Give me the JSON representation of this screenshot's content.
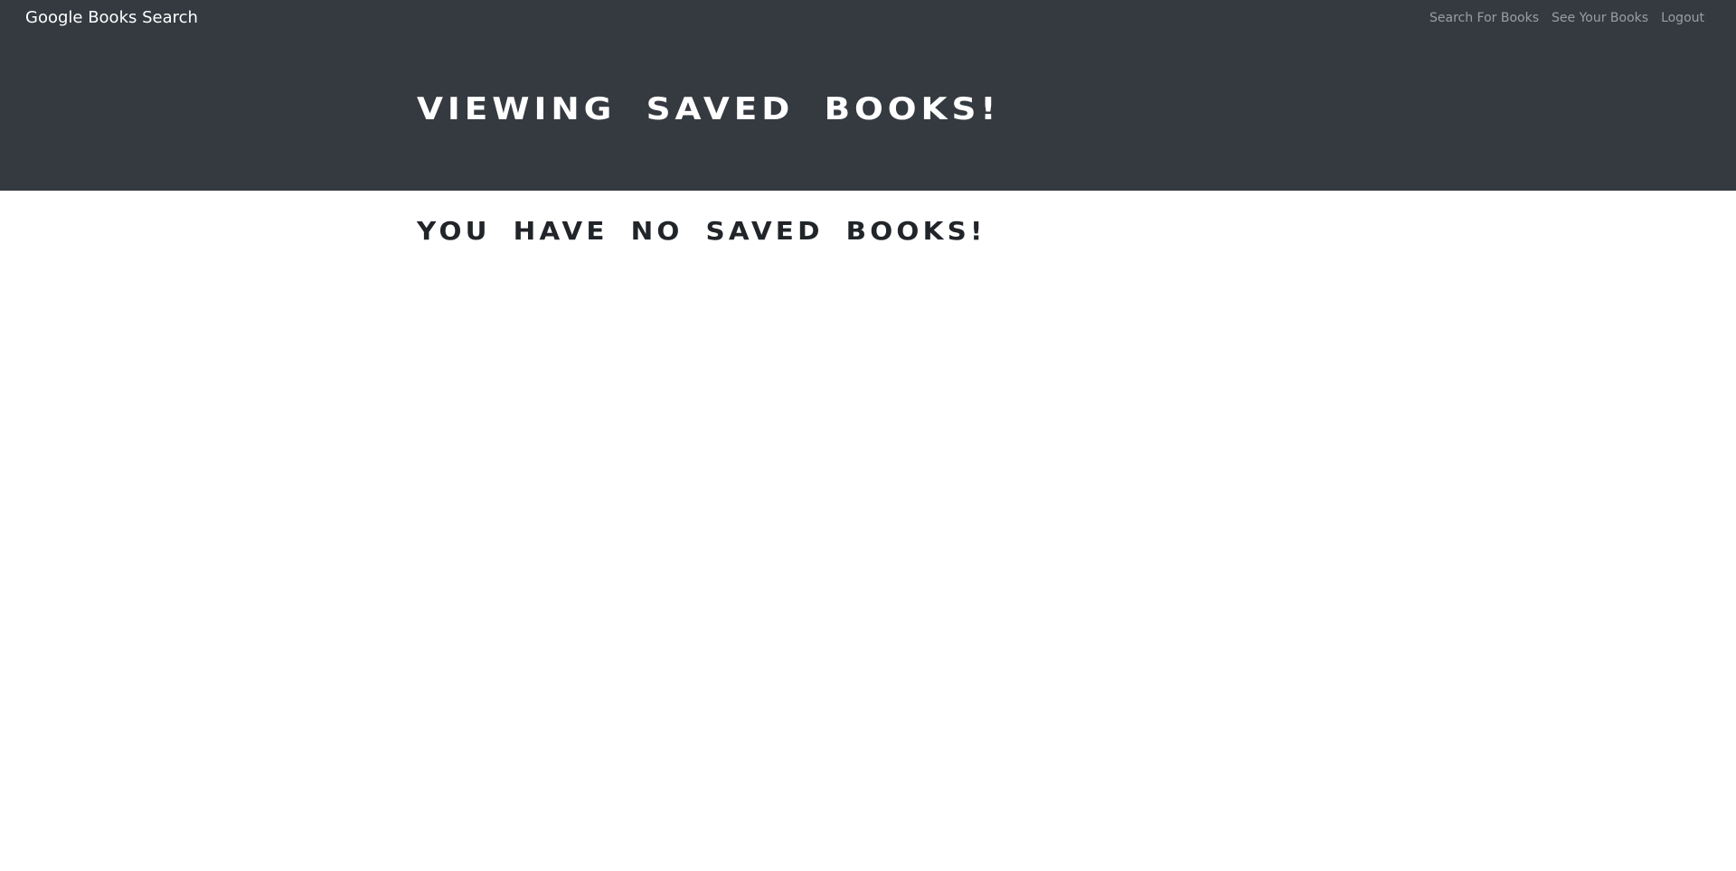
{
  "navbar": {
    "brand": "Google Books Search",
    "links": [
      {
        "label": "Search For Books"
      },
      {
        "label": "See Your Books"
      },
      {
        "label": "Logout"
      }
    ]
  },
  "jumbotron": {
    "title": "Viewing saved books!"
  },
  "main": {
    "empty_message": "You have no saved books!"
  },
  "colors": {
    "navbar_bg": "#343a40",
    "page_bg": "#ffffff",
    "heading_text": "#212529"
  }
}
